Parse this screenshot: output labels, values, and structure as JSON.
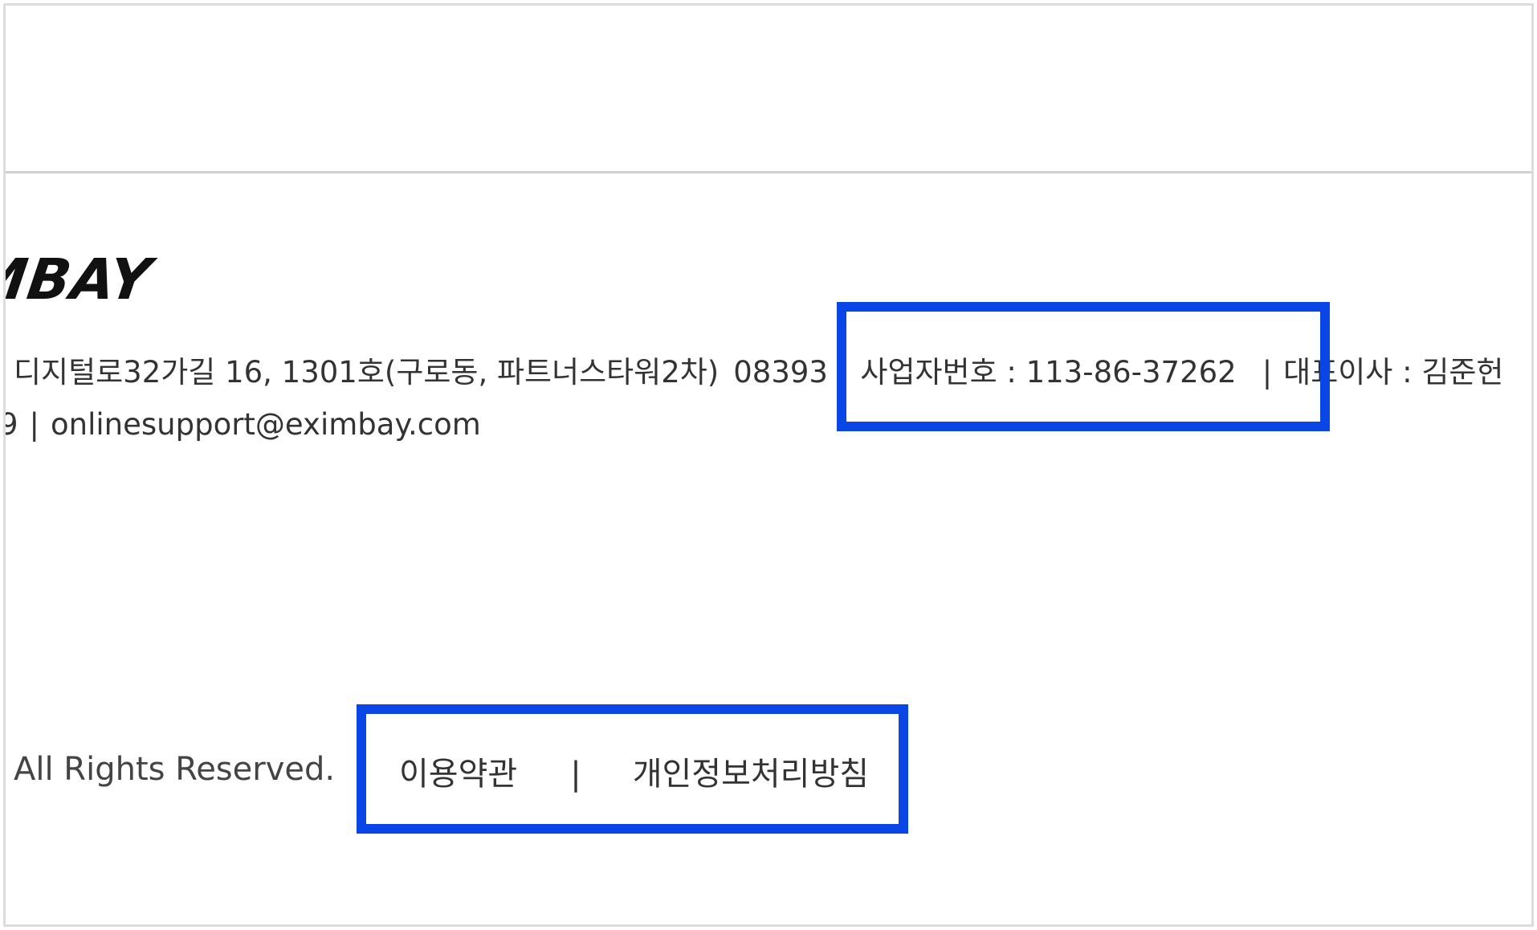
{
  "footer": {
    "logo_text": "IMBAY",
    "address": "디지털로32가길 16, 1301호(구로동, 파트너스타워2차)",
    "postal_code": "08393",
    "separator": "|",
    "business_number": "사업자번호 : 113-86-37262",
    "ceo": "대표이사 : 김준헌",
    "phone_fragment": "9",
    "email": "onlinesupport@eximbay.com",
    "copyright": "All Rights Reserved.",
    "links": {
      "terms": "이용약관",
      "privacy": "개인정보처리방침"
    }
  },
  "colors": {
    "highlight": "#0a46e6",
    "divider": "#d0d0d0",
    "text": "#333333"
  }
}
